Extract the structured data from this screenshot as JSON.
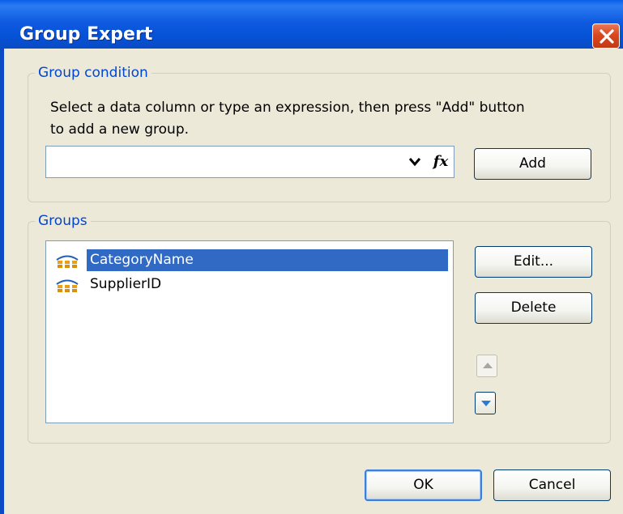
{
  "window": {
    "title": "Group Expert"
  },
  "group_condition": {
    "legend": "Group condition",
    "instruction_line1": "Select a data column or type an expression, then press \"Add\" button",
    "instruction_line2": "to add a new group.",
    "expression_value": "",
    "fx_label": "fx",
    "add_label": "Add"
  },
  "groups": {
    "legend": "Groups",
    "items": [
      {
        "label": "CategoryName",
        "selected": true
      },
      {
        "label": "SupplierID",
        "selected": false
      }
    ],
    "edit_label": "Edit...",
    "delete_label": "Delete"
  },
  "footer": {
    "ok_label": "OK",
    "cancel_label": "Cancel"
  },
  "colors": {
    "title_bar": "#0A4BC4",
    "selection": "#316AC5",
    "legend_text": "#0046D5",
    "dialog_bg": "#ECE9D8"
  },
  "icons": {
    "close": "close-icon",
    "dropdown": "chevron-down-icon",
    "formula": "fx-icon",
    "group_item": "group-field-icon",
    "move_up": "arrow-up-icon",
    "move_down": "arrow-down-icon"
  }
}
